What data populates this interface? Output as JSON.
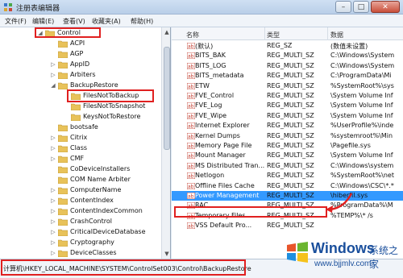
{
  "window": {
    "title": "注册表编辑器",
    "minimize": "–",
    "maximize": "□",
    "close": "✕"
  },
  "menu": [
    "文件(F)",
    "编辑(E)",
    "查看(V)",
    "收藏夹(A)",
    "帮助(H)"
  ],
  "tree": {
    "items": [
      {
        "label": "Control",
        "level": 0,
        "expander": "◢",
        "highlight": true
      },
      {
        "label": "ACPI",
        "level": 1,
        "expander": ""
      },
      {
        "label": "AGP",
        "level": 1,
        "expander": ""
      },
      {
        "label": "AppID",
        "level": 1,
        "expander": "▷"
      },
      {
        "label": "Arbiters",
        "level": 1,
        "expander": "▷"
      },
      {
        "label": "BackupRestore",
        "level": 1,
        "expander": "◢"
      },
      {
        "label": "FilesNotToBackup",
        "level": 2,
        "expander": "",
        "highlight": true
      },
      {
        "label": "FilesNotToSnapshot",
        "level": 2,
        "expander": ""
      },
      {
        "label": "KeysNotToRestore",
        "level": 2,
        "expander": ""
      },
      {
        "label": "bootsafe",
        "level": 1,
        "expander": ""
      },
      {
        "label": "Citrix",
        "level": 1,
        "expander": "▷"
      },
      {
        "label": "Class",
        "level": 1,
        "expander": "▷"
      },
      {
        "label": "CMF",
        "level": 1,
        "expander": "▷"
      },
      {
        "label": "CoDeviceInstallers",
        "level": 1,
        "expander": ""
      },
      {
        "label": "COM Name Arbiter",
        "level": 1,
        "expander": ""
      },
      {
        "label": "ComputerName",
        "level": 1,
        "expander": "▷"
      },
      {
        "label": "ContentIndex",
        "level": 1,
        "expander": "▷"
      },
      {
        "label": "ContentIndexCommon",
        "level": 1,
        "expander": "▷"
      },
      {
        "label": "CrashControl",
        "level": 1,
        "expander": "▷"
      },
      {
        "label": "CriticalDeviceDatabase",
        "level": 1,
        "expander": "▷"
      },
      {
        "label": "Cryptography",
        "level": 1,
        "expander": "▷"
      },
      {
        "label": "DeviceClasses",
        "level": 1,
        "expander": "▷"
      }
    ],
    "scroll_up": "▲",
    "scroll_down": "▼"
  },
  "values": {
    "columns": [
      "名称",
      "类型",
      "数据"
    ],
    "rows": [
      {
        "name": "(默认)",
        "type": "REG_SZ",
        "data": "(数值未设置)"
      },
      {
        "name": "BITS_BAK",
        "type": "REG_MULTI_SZ",
        "data": "C:\\Windows\\System"
      },
      {
        "name": "BITS_LOG",
        "type": "REG_MULTI_SZ",
        "data": "C:\\Windows\\System"
      },
      {
        "name": "BITS_metadata",
        "type": "REG_MULTI_SZ",
        "data": "C:\\ProgramData\\Mi"
      },
      {
        "name": "ETW",
        "type": "REG_MULTI_SZ",
        "data": "%SystemRoot%\\sys"
      },
      {
        "name": "FVE_Control",
        "type": "REG_MULTI_SZ",
        "data": "\\System Volume Inf"
      },
      {
        "name": "FVE_Log",
        "type": "REG_MULTI_SZ",
        "data": "\\System Volume Inf"
      },
      {
        "name": "FVE_Wipe",
        "type": "REG_MULTI_SZ",
        "data": "\\System Volume Inf"
      },
      {
        "name": "Internet Explorer",
        "type": "REG_MULTI_SZ",
        "data": "%UserProfile%\\inde"
      },
      {
        "name": "Kernel Dumps",
        "type": "REG_MULTI_SZ",
        "data": "%systemroot%\\Min"
      },
      {
        "name": "Memory Page File",
        "type": "REG_MULTI_SZ",
        "data": "\\Pagefile.sys"
      },
      {
        "name": "Mount Manager",
        "type": "REG_MULTI_SZ",
        "data": "\\System Volume Inf"
      },
      {
        "name": "MS Distributed Tran...",
        "type": "REG_MULTI_SZ",
        "data": "C:\\Windows\\system"
      },
      {
        "name": "Netlogon",
        "type": "REG_MULTI_SZ",
        "data": "%SystemRoot%\\net"
      },
      {
        "name": "Offline Files Cache",
        "type": "REG_MULTI_SZ",
        "data": "C:\\Windows\\CSC\\*.*"
      },
      {
        "name": "Power Management",
        "type": "REG_MULTI_SZ",
        "data": "\\hiberfil.sys",
        "selected": true
      },
      {
        "name": "RAC",
        "type": "REG_MULTI_SZ",
        "data": "%ProgramData%\\M"
      },
      {
        "name": "Temporary Files",
        "type": "REG_MULTI_SZ",
        "data": "%TEMP%\\* /s"
      },
      {
        "name": "VSS Default Pro...",
        "type": "REG_MULTI_SZ",
        "data": ""
      }
    ]
  },
  "status": {
    "path": "计算机\\HKEY_LOCAL_MACHINE\\SYSTEM\\ControlSet003\\Control\\BackupRestore"
  },
  "watermark": {
    "brand": "Windows",
    "cn": "系统之家",
    "url": "www.bjjmlv.com"
  },
  "colors": {
    "highlight_box": "#e02020",
    "selection": "#3399ff",
    "folder": "#e8c25a"
  }
}
